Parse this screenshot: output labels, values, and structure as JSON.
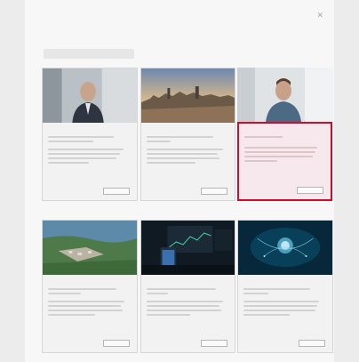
{
  "header": {
    "logo_brand": "",
    "logo_suffix": "",
    "tagline": ""
  },
  "close_icon": "close-icon",
  "filter_pill": "",
  "highlight_color": "#c8102e",
  "cards": [
    {
      "tag": "",
      "title": "",
      "description": "",
      "button": "",
      "image": "portrait-man-in-suit"
    },
    {
      "tag": "",
      "title": "",
      "description": "",
      "button": "",
      "image": "city-skyline-at-dusk"
    },
    {
      "tag": "",
      "title": "",
      "description": "",
      "button": "",
      "image": "portrait-man-in-office",
      "highlighted": true
    },
    {
      "tag": "",
      "title": "",
      "description": "",
      "button": "",
      "image": "aerial-town-by-lake"
    },
    {
      "tag": "",
      "title": "",
      "description": "",
      "button": "",
      "image": "trading-screens-and-phone"
    },
    {
      "tag": "",
      "title": "",
      "description": "",
      "button": "",
      "image": "underwater-data-network"
    }
  ]
}
